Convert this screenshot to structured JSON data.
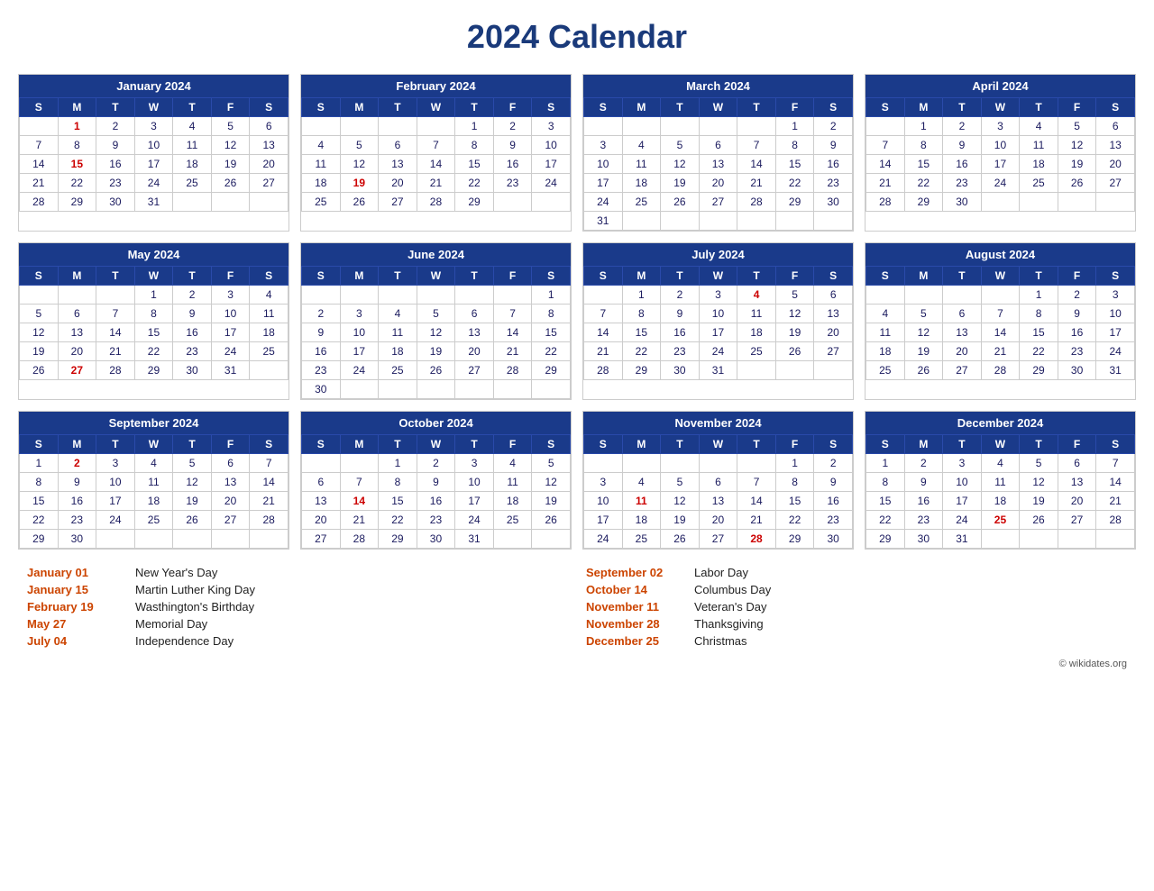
{
  "title": "2024 Calendar",
  "months": [
    {
      "name": "January 2024",
      "days_header": [
        "S",
        "M",
        "T",
        "W",
        "T",
        "F",
        "S"
      ],
      "weeks": [
        [
          "",
          "1",
          "2",
          "3",
          "4",
          "5",
          "6"
        ],
        [
          "7",
          "8",
          "9",
          "10",
          "11",
          "12",
          "13"
        ],
        [
          "14",
          "15",
          "16",
          "17",
          "18",
          "19",
          "20"
        ],
        [
          "21",
          "22",
          "23",
          "24",
          "25",
          "26",
          "27"
        ],
        [
          "28",
          "29",
          "30",
          "31",
          "",
          "",
          ""
        ]
      ],
      "red_days": [
        "1",
        "15"
      ]
    },
    {
      "name": "February 2024",
      "days_header": [
        "S",
        "M",
        "T",
        "W",
        "T",
        "F",
        "S"
      ],
      "weeks": [
        [
          "",
          "",
          "",
          "",
          "1",
          "2",
          "3"
        ],
        [
          "4",
          "5",
          "6",
          "7",
          "8",
          "9",
          "10"
        ],
        [
          "11",
          "12",
          "13",
          "14",
          "15",
          "16",
          "17"
        ],
        [
          "18",
          "19",
          "20",
          "21",
          "22",
          "23",
          "24"
        ],
        [
          "25",
          "26",
          "27",
          "28",
          "29",
          "",
          ""
        ]
      ],
      "red_days": [
        "19"
      ]
    },
    {
      "name": "March 2024",
      "days_header": [
        "S",
        "M",
        "T",
        "W",
        "T",
        "F",
        "S"
      ],
      "weeks": [
        [
          "",
          "",
          "",
          "",
          "",
          "1",
          "2"
        ],
        [
          "3",
          "4",
          "5",
          "6",
          "7",
          "8",
          "9"
        ],
        [
          "10",
          "11",
          "12",
          "13",
          "14",
          "15",
          "16"
        ],
        [
          "17",
          "18",
          "19",
          "20",
          "21",
          "22",
          "23"
        ],
        [
          "24",
          "25",
          "26",
          "27",
          "28",
          "29",
          "30"
        ],
        [
          "31",
          "",
          "",
          "",
          "",
          "",
          ""
        ]
      ],
      "red_days": []
    },
    {
      "name": "April 2024",
      "days_header": [
        "S",
        "M",
        "T",
        "W",
        "T",
        "F",
        "S"
      ],
      "weeks": [
        [
          "",
          "1",
          "2",
          "3",
          "4",
          "5",
          "6"
        ],
        [
          "7",
          "8",
          "9",
          "10",
          "11",
          "12",
          "13"
        ],
        [
          "14",
          "15",
          "16",
          "17",
          "18",
          "19",
          "20"
        ],
        [
          "21",
          "22",
          "23",
          "24",
          "25",
          "26",
          "27"
        ],
        [
          "28",
          "29",
          "30",
          "",
          "",
          "",
          ""
        ]
      ],
      "red_days": []
    },
    {
      "name": "May 2024",
      "days_header": [
        "S",
        "M",
        "T",
        "W",
        "T",
        "F",
        "S"
      ],
      "weeks": [
        [
          "",
          "",
          "",
          "1",
          "2",
          "3",
          "4"
        ],
        [
          "5",
          "6",
          "7",
          "8",
          "9",
          "10",
          "11"
        ],
        [
          "12",
          "13",
          "14",
          "15",
          "16",
          "17",
          "18"
        ],
        [
          "19",
          "20",
          "21",
          "22",
          "23",
          "24",
          "25"
        ],
        [
          "26",
          "27",
          "28",
          "29",
          "30",
          "31",
          ""
        ]
      ],
      "red_days": [
        "27"
      ]
    },
    {
      "name": "June 2024",
      "days_header": [
        "S",
        "M",
        "T",
        "W",
        "T",
        "F",
        "S"
      ],
      "weeks": [
        [
          "",
          "",
          "",
          "",
          "",
          "",
          "1"
        ],
        [
          "2",
          "3",
          "4",
          "5",
          "6",
          "7",
          "8"
        ],
        [
          "9",
          "10",
          "11",
          "12",
          "13",
          "14",
          "15"
        ],
        [
          "16",
          "17",
          "18",
          "19",
          "20",
          "21",
          "22"
        ],
        [
          "23",
          "24",
          "25",
          "26",
          "27",
          "28",
          "29"
        ],
        [
          "30",
          "",
          "",
          "",
          "",
          "",
          ""
        ]
      ],
      "red_days": []
    },
    {
      "name": "July 2024",
      "days_header": [
        "S",
        "M",
        "T",
        "W",
        "T",
        "F",
        "S"
      ],
      "weeks": [
        [
          "",
          "1",
          "2",
          "3",
          "4",
          "5",
          "6"
        ],
        [
          "7",
          "8",
          "9",
          "10",
          "11",
          "12",
          "13"
        ],
        [
          "14",
          "15",
          "16",
          "17",
          "18",
          "19",
          "20"
        ],
        [
          "21",
          "22",
          "23",
          "24",
          "25",
          "26",
          "27"
        ],
        [
          "28",
          "29",
          "30",
          "31",
          "",
          "",
          ""
        ]
      ],
      "red_days": [
        "4"
      ]
    },
    {
      "name": "August 2024",
      "days_header": [
        "S",
        "M",
        "T",
        "W",
        "T",
        "F",
        "S"
      ],
      "weeks": [
        [
          "",
          "",
          "",
          "",
          "1",
          "2",
          "3"
        ],
        [
          "4",
          "5",
          "6",
          "7",
          "8",
          "9",
          "10"
        ],
        [
          "11",
          "12",
          "13",
          "14",
          "15",
          "16",
          "17"
        ],
        [
          "18",
          "19",
          "20",
          "21",
          "22",
          "23",
          "24"
        ],
        [
          "25",
          "26",
          "27",
          "28",
          "29",
          "30",
          "31"
        ]
      ],
      "red_days": []
    },
    {
      "name": "September 2024",
      "days_header": [
        "S",
        "M",
        "T",
        "W",
        "T",
        "F",
        "S"
      ],
      "weeks": [
        [
          "1",
          "2",
          "3",
          "4",
          "5",
          "6",
          "7"
        ],
        [
          "8",
          "9",
          "10",
          "11",
          "12",
          "13",
          "14"
        ],
        [
          "15",
          "16",
          "17",
          "18",
          "19",
          "20",
          "21"
        ],
        [
          "22",
          "23",
          "24",
          "25",
          "26",
          "27",
          "28"
        ],
        [
          "29",
          "30",
          "",
          "",
          "",
          "",
          ""
        ]
      ],
      "red_days": [
        "2"
      ]
    },
    {
      "name": "October 2024",
      "days_header": [
        "S",
        "M",
        "T",
        "W",
        "T",
        "F",
        "S"
      ],
      "weeks": [
        [
          "",
          "",
          "1",
          "2",
          "3",
          "4",
          "5"
        ],
        [
          "6",
          "7",
          "8",
          "9",
          "10",
          "11",
          "12"
        ],
        [
          "13",
          "14",
          "15",
          "16",
          "17",
          "18",
          "19"
        ],
        [
          "20",
          "21",
          "22",
          "23",
          "24",
          "25",
          "26"
        ],
        [
          "27",
          "28",
          "29",
          "30",
          "31",
          "",
          ""
        ]
      ],
      "red_days": [
        "14"
      ]
    },
    {
      "name": "November 2024",
      "days_header": [
        "S",
        "M",
        "T",
        "W",
        "T",
        "F",
        "S"
      ],
      "weeks": [
        [
          "",
          "",
          "",
          "",
          "",
          "1",
          "2"
        ],
        [
          "3",
          "4",
          "5",
          "6",
          "7",
          "8",
          "9"
        ],
        [
          "10",
          "11",
          "12",
          "13",
          "14",
          "15",
          "16"
        ],
        [
          "17",
          "18",
          "19",
          "20",
          "21",
          "22",
          "23"
        ],
        [
          "24",
          "25",
          "26",
          "27",
          "28",
          "29",
          "30"
        ]
      ],
      "red_days": [
        "11",
        "28"
      ]
    },
    {
      "name": "December 2024",
      "days_header": [
        "S",
        "M",
        "T",
        "W",
        "T",
        "F",
        "S"
      ],
      "weeks": [
        [
          "1",
          "2",
          "3",
          "4",
          "5",
          "6",
          "7"
        ],
        [
          "8",
          "9",
          "10",
          "11",
          "12",
          "13",
          "14"
        ],
        [
          "15",
          "16",
          "17",
          "18",
          "19",
          "20",
          "21"
        ],
        [
          "22",
          "23",
          "24",
          "25",
          "26",
          "27",
          "28"
        ],
        [
          "29",
          "30",
          "31",
          "",
          "",
          "",
          ""
        ]
      ],
      "red_days": [
        "25"
      ]
    }
  ],
  "holidays_left": [
    {
      "date": "January 01",
      "name": "New Year's Day"
    },
    {
      "date": "January 15",
      "name": "Martin Luther King Day"
    },
    {
      "date": "February 19",
      "name": "Wasthington's Birthday"
    },
    {
      "date": "May 27",
      "name": "Memorial Day"
    },
    {
      "date": "July 04",
      "name": "Independence Day"
    }
  ],
  "holidays_right": [
    {
      "date": "September 02",
      "name": "Labor Day"
    },
    {
      "date": "October 14",
      "name": "Columbus Day"
    },
    {
      "date": "November 11",
      "name": "Veteran's Day"
    },
    {
      "date": "November 28",
      "name": "Thanksgiving"
    },
    {
      "date": "December 25",
      "name": "Christmas"
    }
  ],
  "copyright": "© wikidates.org"
}
